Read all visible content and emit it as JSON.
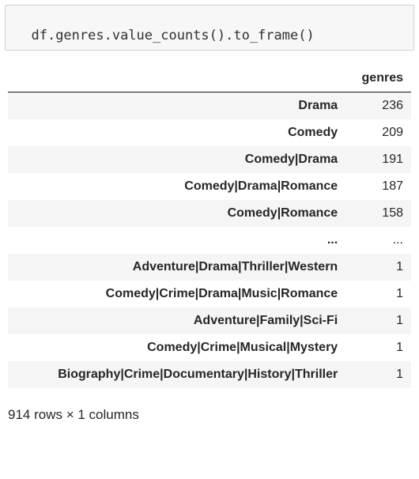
{
  "code": "df.genres.value_counts().to_frame()",
  "table": {
    "column_header": "genres",
    "rows": [
      {
        "index": "Drama",
        "value": "236"
      },
      {
        "index": "Comedy",
        "value": "209"
      },
      {
        "index": "Comedy|Drama",
        "value": "191"
      },
      {
        "index": "Comedy|Drama|Romance",
        "value": "187"
      },
      {
        "index": "Comedy|Romance",
        "value": "158"
      },
      {
        "index": "...",
        "value": "..."
      },
      {
        "index": "Adventure|Drama|Thriller|Western",
        "value": "1"
      },
      {
        "index": "Comedy|Crime|Drama|Music|Romance",
        "value": "1"
      },
      {
        "index": "Adventure|Family|Sci-Fi",
        "value": "1"
      },
      {
        "index": "Comedy|Crime|Musical|Mystery",
        "value": "1"
      },
      {
        "index": "Biography|Crime|Documentary|History|Thriller",
        "value": "1"
      }
    ]
  },
  "dimensions": "914 rows × 1 columns"
}
